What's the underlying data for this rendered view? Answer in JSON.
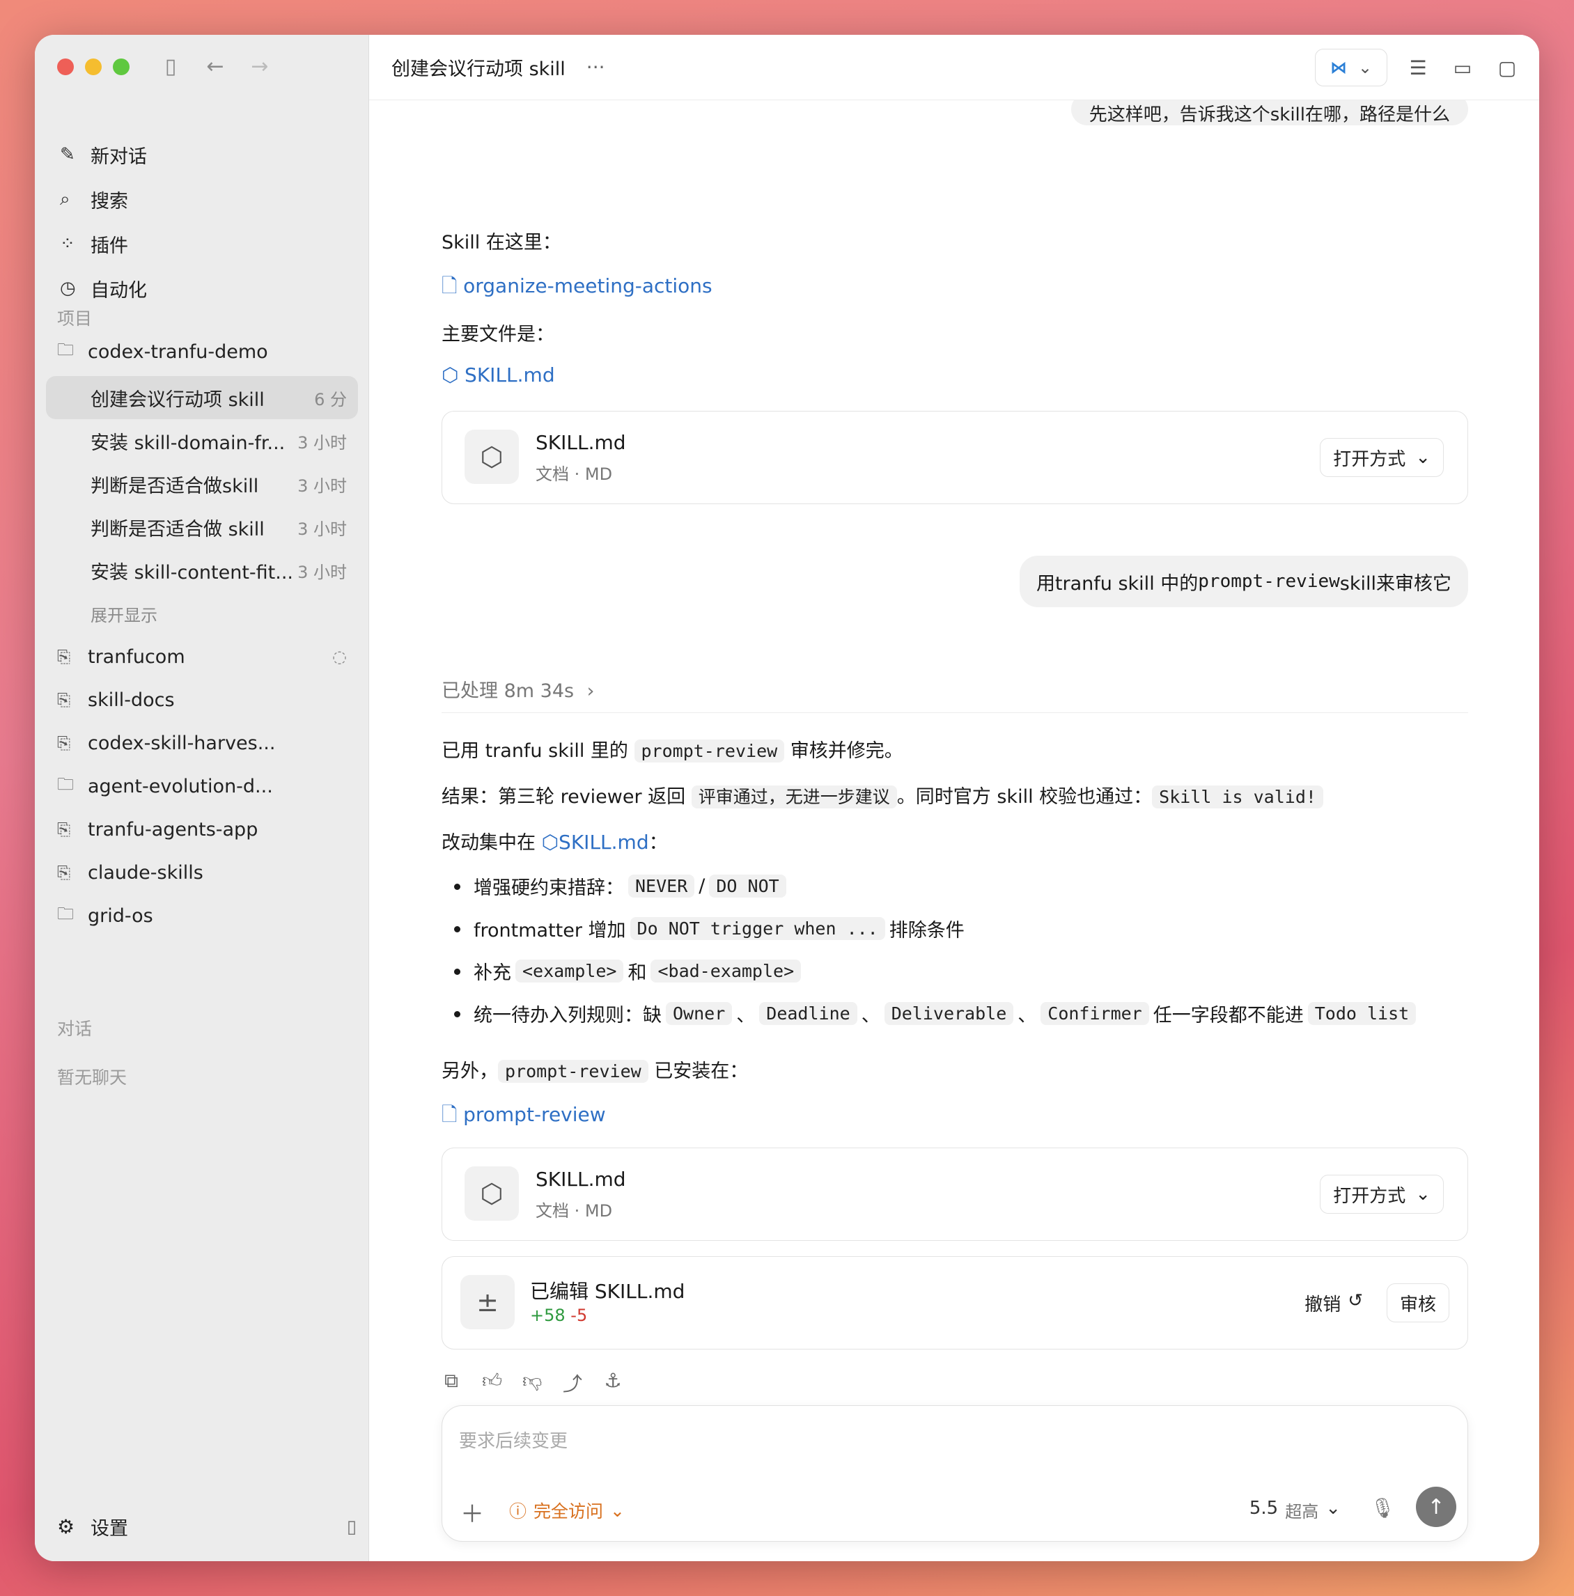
{
  "sidebar": {
    "nav": [
      {
        "icon": "compose-icon",
        "glyph": "✎",
        "label": "新对话"
      },
      {
        "icon": "search-icon",
        "glyph": "⌕",
        "label": "搜索"
      },
      {
        "icon": "plugins-icon",
        "glyph": "⁘",
        "label": "插件"
      },
      {
        "icon": "clock-icon",
        "glyph": "◷",
        "label": "自动化"
      }
    ],
    "projects_label": "项目",
    "projects": {
      "main": "codex-tranfu-demo",
      "threads": [
        {
          "label": "创建会议行动项 skill",
          "time": "6 分"
        },
        {
          "label": "安装 skill-domain-fr...",
          "time": "3 小时"
        },
        {
          "label": "判断是否适合做skill",
          "time": "3 小时"
        },
        {
          "label": "判断是否适合做 skill",
          "time": "3 小时"
        },
        {
          "label": "安装 skill-content-fit...",
          "time": "3 小时"
        }
      ],
      "expand": "展开显示",
      "others": [
        "tranfucom",
        "skill-docs",
        "codex-skill-harves...",
        "agent-evolution-d...",
        "tranfu-agents-app",
        "claude-skills",
        "grid-os"
      ]
    },
    "chats_label": "对话",
    "no_chats": "暂无聊天",
    "settings": "设置"
  },
  "topbar": {
    "title": "创建会议行动项 skill",
    "more": "···"
  },
  "conversation": {
    "top_bubble": "先这样吧，告诉我这个skill在哪，路径是什么",
    "skill_here": "Skill 在这里：",
    "folder_link": "organize-meeting-actions",
    "main_file": "主要文件是：",
    "skill_link": "SKILL.md",
    "file_card": {
      "name": "SKILL.md",
      "meta": "文档 · MD",
      "open_with": "打开方式"
    },
    "user_msg_pre": "用tranfu skill 中的 ",
    "user_msg_code": "prompt-review",
    "user_msg_post": " skill来审核它",
    "processed": "已处理 8m 34s",
    "done_pre": "已用 tranfu skill 里的 ",
    "done_code": "prompt-review",
    "done_post": " 审核并修完。",
    "result_pre": "结果：第三轮 reviewer 返回 ",
    "result_code1": "评审通过，无进一步建议",
    "result_mid": "。同时官方 skill 校验也通过：",
    "result_code2": "Skill is valid!",
    "changes_pre": "改动集中在 ",
    "changes_link": "SKILL.md",
    "changes_post": "：",
    "b1_pre": "增强硬约束措辞：",
    "b1_c1": "NEVER",
    "b1_sep": "/",
    "b1_c2": "DO NOT",
    "b2_pre": "frontmatter 增加",
    "b2_c": "Do NOT trigger when ...",
    "b2_post": "排除条件",
    "b3_pre": "补充",
    "b3_c1": "<example>",
    "b3_mid": "和",
    "b3_c2": "<bad-example>",
    "b4_pre": "统一待办入列规则：缺",
    "b4_c1": "Owner",
    "b4_c2": "Deadline",
    "b4_c3": "Deliverable",
    "b4_c4": "Confirmer",
    "b4_sep": "、",
    "b4_mid": "任一字段都不能进",
    "b4_c5": "Todo list",
    "also_pre": "另外，",
    "also_code": "prompt-review",
    "also_post": " 已安装在：",
    "review_link": "prompt-review",
    "file_card2": {
      "name": "SKILL.md",
      "meta": "文档 · MD",
      "open_with": "打开方式"
    },
    "edit_card": {
      "title": "已编辑 SKILL.md",
      "plus": "+58",
      "minus": "-5",
      "undo": "撤销",
      "review": "审核"
    }
  },
  "composer": {
    "placeholder": "要求后续变更",
    "access": "完全访问",
    "model": "5.5",
    "level": "超高"
  },
  "colors": {
    "link": "#2e6fc4",
    "access": "#d8701e",
    "plus": "#2f9a3f",
    "minus": "#d0392f"
  }
}
